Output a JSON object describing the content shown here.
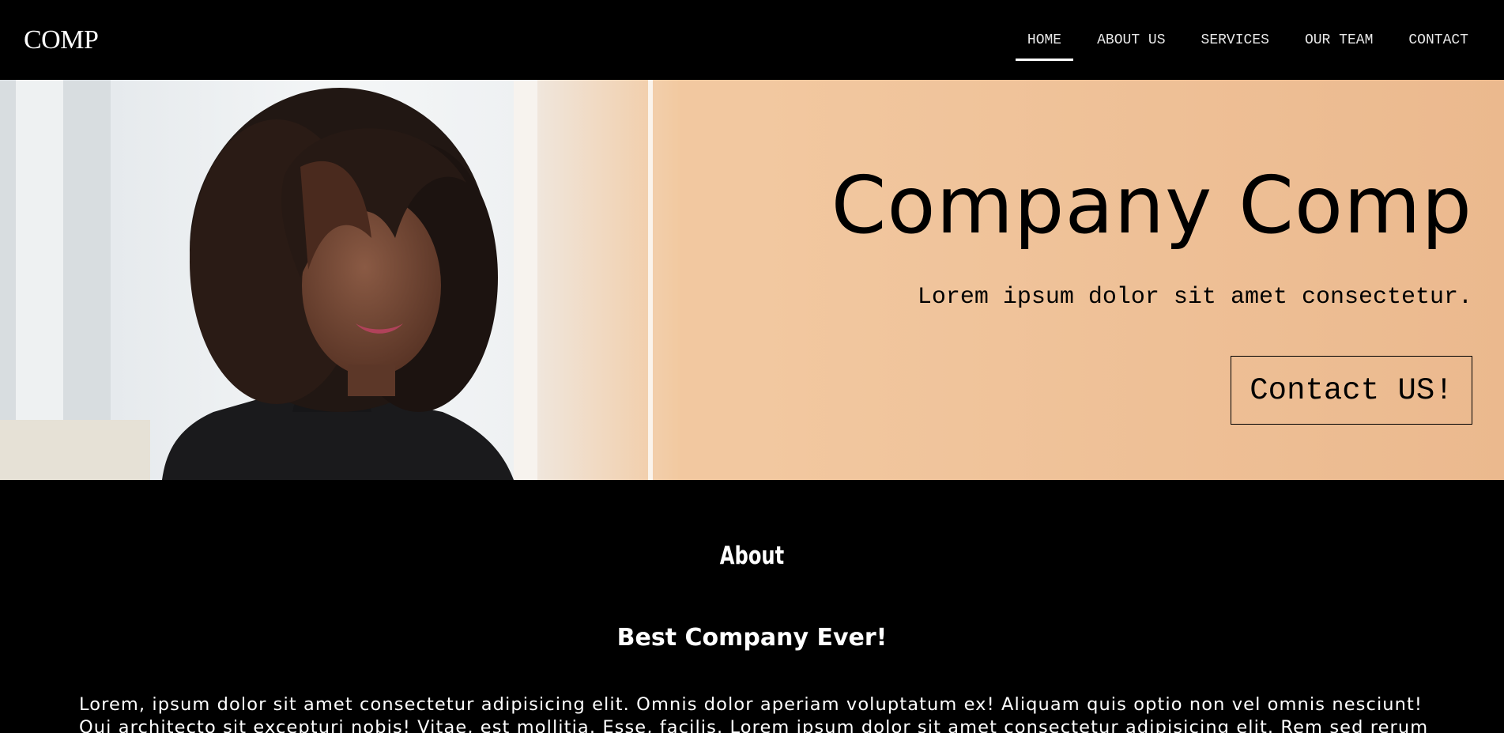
{
  "navbar": {
    "logo": "COMP",
    "links": [
      {
        "label": "HOME",
        "active": true
      },
      {
        "label": "ABOUT US",
        "active": false
      },
      {
        "label": "SERVICES",
        "active": false
      },
      {
        "label": "OUR TEAM",
        "active": false
      },
      {
        "label": "CONTACT",
        "active": false
      }
    ]
  },
  "hero": {
    "title": "Company Comp",
    "subtitle": "Lorem ipsum dolor sit amet consectetur.",
    "cta_label": "Contact US!",
    "background_color": "#f1c9a0"
  },
  "about": {
    "heading": "About",
    "subheading": "Best Company Ever!",
    "body": "Lorem, ipsum dolor sit amet consectetur adipisicing elit. Omnis dolor aperiam voluptatum ex! Aliquam quis optio non vel omnis nesciunt! Qui architecto sit excepturi nobis! Vitae, est mollitia. Esse, facilis. Lorem ipsum dolor sit amet consectetur adipisicing elit. Rem sed rerum"
  }
}
